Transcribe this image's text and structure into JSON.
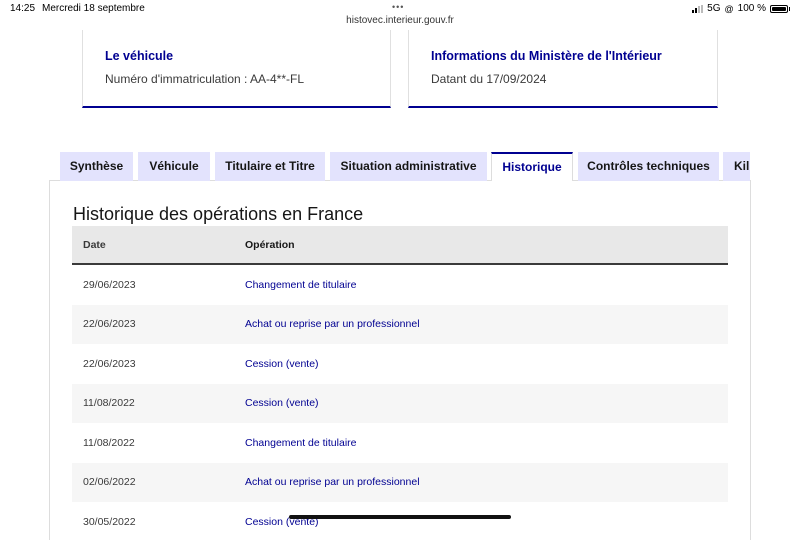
{
  "status_bar": {
    "time": "14:25",
    "date": "Mercredi 18 septembre",
    "dots": "•••",
    "url": "histovec.interieur.gouv.fr",
    "network": "5G",
    "battery": "100 %"
  },
  "cards": {
    "vehicle": {
      "title": "Le véhicule",
      "text": "Numéro d'immatriculation : AA-4**-FL"
    },
    "ministry": {
      "title": "Informations du Ministère de l'Intérieur",
      "text": "Datant du 17/09/2024"
    }
  },
  "tabs": [
    {
      "label": "Synthèse"
    },
    {
      "label": "Véhicule"
    },
    {
      "label": "Titulaire et Titre"
    },
    {
      "label": "Situation administrative"
    },
    {
      "label": "Historique",
      "active": true
    },
    {
      "label": "Contrôles techniques"
    },
    {
      "label": "Kil"
    }
  ],
  "history": {
    "title": "Historique des opérations en France",
    "columns": {
      "date": "Date",
      "operation": "Opération"
    },
    "rows": [
      {
        "date": "29/06/2023",
        "operation": "Changement de titulaire"
      },
      {
        "date": "22/06/2023",
        "operation": "Achat ou reprise par un professionnel"
      },
      {
        "date": "22/06/2023",
        "operation": "Cession (vente)"
      },
      {
        "date": "11/08/2022",
        "operation": "Cession (vente)"
      },
      {
        "date": "11/08/2022",
        "operation": "Changement de titulaire"
      },
      {
        "date": "02/06/2022",
        "operation": "Achat ou reprise par un professionnel"
      },
      {
        "date": "30/05/2022",
        "operation": "Cession (vente)"
      }
    ]
  },
  "colors": {
    "accent": "#000091",
    "tab_bg": "#e3e3fd",
    "header_bg": "#e8e8e8",
    "row_alt": "#f6f6f6"
  }
}
